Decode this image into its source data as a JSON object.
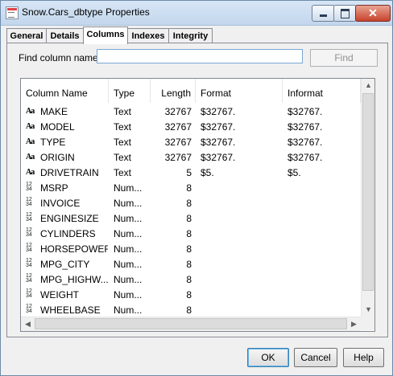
{
  "window": {
    "title": "Snow.Cars_dbtype Properties",
    "close_glyph": "✕"
  },
  "tabs": [
    {
      "label": "General"
    },
    {
      "label": "Details"
    },
    {
      "label": "Columns"
    },
    {
      "label": "Indexes"
    },
    {
      "label": "Integrity"
    }
  ],
  "find": {
    "label": "Find column name:",
    "value": "",
    "button": "Find"
  },
  "table": {
    "headers": [
      "Column Name",
      "Type",
      "Length",
      "Format",
      "Informat"
    ],
    "rows": [
      {
        "name": "MAKE",
        "icon": "character-column-icon",
        "type": "Text",
        "length": "32767",
        "format": "$32767.",
        "informat": "$32767."
      },
      {
        "name": "MODEL",
        "icon": "character-column-icon",
        "type": "Text",
        "length": "32767",
        "format": "$32767.",
        "informat": "$32767."
      },
      {
        "name": "TYPE",
        "icon": "character-column-icon",
        "type": "Text",
        "length": "32767",
        "format": "$32767.",
        "informat": "$32767."
      },
      {
        "name": "ORIGIN",
        "icon": "character-column-icon",
        "type": "Text",
        "length": "32767",
        "format": "$32767.",
        "informat": "$32767."
      },
      {
        "name": "DRIVETRAIN",
        "icon": "character-column-icon",
        "type": "Text",
        "length": "5",
        "format": "$5.",
        "informat": "$5."
      },
      {
        "name": "MSRP",
        "icon": "numeric-column-icon",
        "type": "Num...",
        "length": "8",
        "format": "",
        "informat": ""
      },
      {
        "name": "INVOICE",
        "icon": "numeric-column-icon",
        "type": "Num...",
        "length": "8",
        "format": "",
        "informat": ""
      },
      {
        "name": "ENGINESIZE",
        "icon": "numeric-column-icon",
        "type": "Num...",
        "length": "8",
        "format": "",
        "informat": ""
      },
      {
        "name": "CYLINDERS",
        "icon": "numeric-column-icon",
        "type": "Num...",
        "length": "8",
        "format": "",
        "informat": ""
      },
      {
        "name": "HORSEPOWER",
        "icon": "numeric-column-icon",
        "type": "Num...",
        "length": "8",
        "format": "",
        "informat": ""
      },
      {
        "name": "MPG_CITY",
        "icon": "numeric-column-icon",
        "type": "Num...",
        "length": "8",
        "format": "",
        "informat": ""
      },
      {
        "name": "MPG_HIGHW...",
        "icon": "numeric-column-icon",
        "type": "Num...",
        "length": "8",
        "format": "",
        "informat": ""
      },
      {
        "name": "WEIGHT",
        "icon": "numeric-column-icon",
        "type": "Num...",
        "length": "8",
        "format": "",
        "informat": ""
      },
      {
        "name": "WHEELBASE",
        "icon": "numeric-column-icon",
        "type": "Num...",
        "length": "8",
        "format": "",
        "informat": ""
      }
    ]
  },
  "icons": {
    "character": "Aa",
    "numeric": "12 34"
  },
  "scroll": {
    "up": "▲",
    "down": "▼",
    "left": "◀",
    "right": "▶"
  },
  "buttons": {
    "ok": "OK",
    "cancel": "Cancel",
    "help": "Help"
  }
}
